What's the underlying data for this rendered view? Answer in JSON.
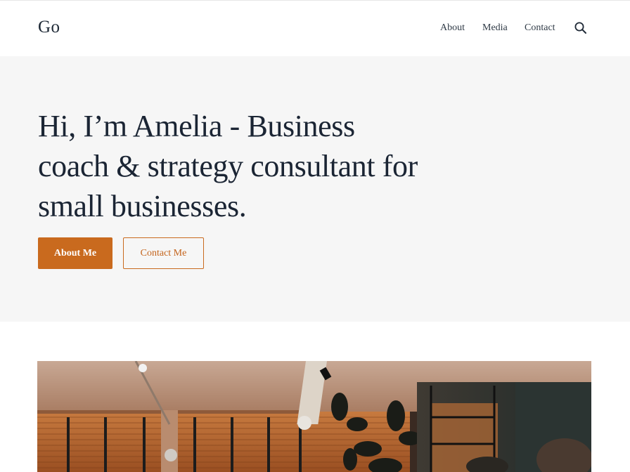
{
  "header": {
    "logo": "Go",
    "nav": [
      "About",
      "Media",
      "Contact"
    ],
    "search_icon": "search-icon"
  },
  "hero": {
    "title": "Hi, I’m Amelia - Business coach & strategy consultant for small businesses.",
    "primary_button": "About Me",
    "secondary_button": "Contact Me"
  },
  "colors": {
    "accent": "#c96a1e",
    "hero_background": "#f6f6f6",
    "text": "#1b2534"
  },
  "media": {
    "image": "cafe-interior-photo"
  }
}
